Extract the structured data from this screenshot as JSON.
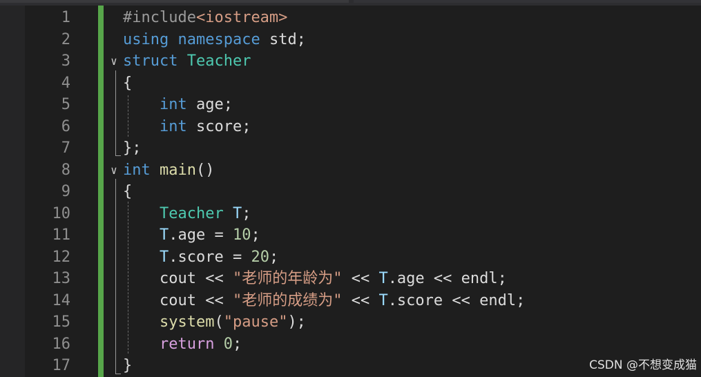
{
  "editor": {
    "lines": [
      {
        "no": "1",
        "tokens": [
          {
            "t": "#include",
            "c": "pp"
          },
          {
            "t": "<iostream>",
            "c": "str"
          }
        ]
      },
      {
        "no": "2",
        "tokens": [
          {
            "t": "using",
            "c": "kw"
          },
          {
            "t": " ",
            "c": "df"
          },
          {
            "t": "namespace",
            "c": "kw"
          },
          {
            "t": " std;",
            "c": "df"
          }
        ]
      },
      {
        "no": "3",
        "tokens": [
          {
            "t": "struct",
            "c": "kw"
          },
          {
            "t": " ",
            "c": "df"
          },
          {
            "t": "Teacher",
            "c": "ty"
          }
        ]
      },
      {
        "no": "4",
        "tokens": [
          {
            "t": "{",
            "c": "df"
          }
        ]
      },
      {
        "no": "5",
        "tokens": [
          {
            "t": "    ",
            "c": "df"
          },
          {
            "t": "int",
            "c": "kw"
          },
          {
            "t": " age;",
            "c": "df"
          }
        ]
      },
      {
        "no": "6",
        "tokens": [
          {
            "t": "    ",
            "c": "df"
          },
          {
            "t": "int",
            "c": "kw"
          },
          {
            "t": " score;",
            "c": "df"
          }
        ]
      },
      {
        "no": "7",
        "tokens": [
          {
            "t": "};",
            "c": "df"
          }
        ]
      },
      {
        "no": "8",
        "tokens": [
          {
            "t": "int",
            "c": "kw"
          },
          {
            "t": " ",
            "c": "df"
          },
          {
            "t": "main",
            "c": "fn"
          },
          {
            "t": "()",
            "c": "df"
          }
        ]
      },
      {
        "no": "9",
        "tokens": [
          {
            "t": "{",
            "c": "df"
          }
        ]
      },
      {
        "no": "10",
        "tokens": [
          {
            "t": "    ",
            "c": "df"
          },
          {
            "t": "Teacher",
            "c": "ty"
          },
          {
            "t": " ",
            "c": "df"
          },
          {
            "t": "T",
            "c": "var"
          },
          {
            "t": ";",
            "c": "df"
          }
        ]
      },
      {
        "no": "11",
        "tokens": [
          {
            "t": "    ",
            "c": "df"
          },
          {
            "t": "T",
            "c": "var"
          },
          {
            "t": ".age = ",
            "c": "df"
          },
          {
            "t": "10",
            "c": "num"
          },
          {
            "t": ";",
            "c": "df"
          }
        ]
      },
      {
        "no": "12",
        "tokens": [
          {
            "t": "    ",
            "c": "df"
          },
          {
            "t": "T",
            "c": "var"
          },
          {
            "t": ".score = ",
            "c": "df"
          },
          {
            "t": "20",
            "c": "num"
          },
          {
            "t": ";",
            "c": "df"
          }
        ]
      },
      {
        "no": "13",
        "tokens": [
          {
            "t": "    cout << ",
            "c": "df"
          },
          {
            "t": "\"老师的年龄为\"",
            "c": "str"
          },
          {
            "t": " << ",
            "c": "df"
          },
          {
            "t": "T",
            "c": "var"
          },
          {
            "t": ".age << endl;",
            "c": "df"
          }
        ]
      },
      {
        "no": "14",
        "tokens": [
          {
            "t": "    cout << ",
            "c": "df"
          },
          {
            "t": "\"老师的成绩为\"",
            "c": "str"
          },
          {
            "t": " << ",
            "c": "df"
          },
          {
            "t": "T",
            "c": "var"
          },
          {
            "t": ".score << endl;",
            "c": "df"
          }
        ]
      },
      {
        "no": "15",
        "tokens": [
          {
            "t": "    ",
            "c": "df"
          },
          {
            "t": "system",
            "c": "fn"
          },
          {
            "t": "(",
            "c": "df"
          },
          {
            "t": "\"pause\"",
            "c": "str"
          },
          {
            "t": ");",
            "c": "df"
          }
        ]
      },
      {
        "no": "16",
        "tokens": [
          {
            "t": "    ",
            "c": "df"
          },
          {
            "t": "return",
            "c": "ctl"
          },
          {
            "t": " ",
            "c": "df"
          },
          {
            "t": "0",
            "c": "num"
          },
          {
            "t": ";",
            "c": "df"
          }
        ]
      },
      {
        "no": "17",
        "tokens": [
          {
            "t": "}",
            "c": "df"
          }
        ]
      }
    ],
    "fold_markers": [
      "3",
      "8"
    ],
    "fold_glyph": "chevron-down-icon"
  },
  "watermark": "CSDN @不想变成猫",
  "colors": {
    "background": "#1e1e1e",
    "keyword": "#569cd6",
    "type": "#4ec9b0",
    "function": "#dcdcaa",
    "string": "#d69d85",
    "number": "#b5cea8",
    "control": "#d8a0df",
    "change_bar": "#57a64a"
  }
}
